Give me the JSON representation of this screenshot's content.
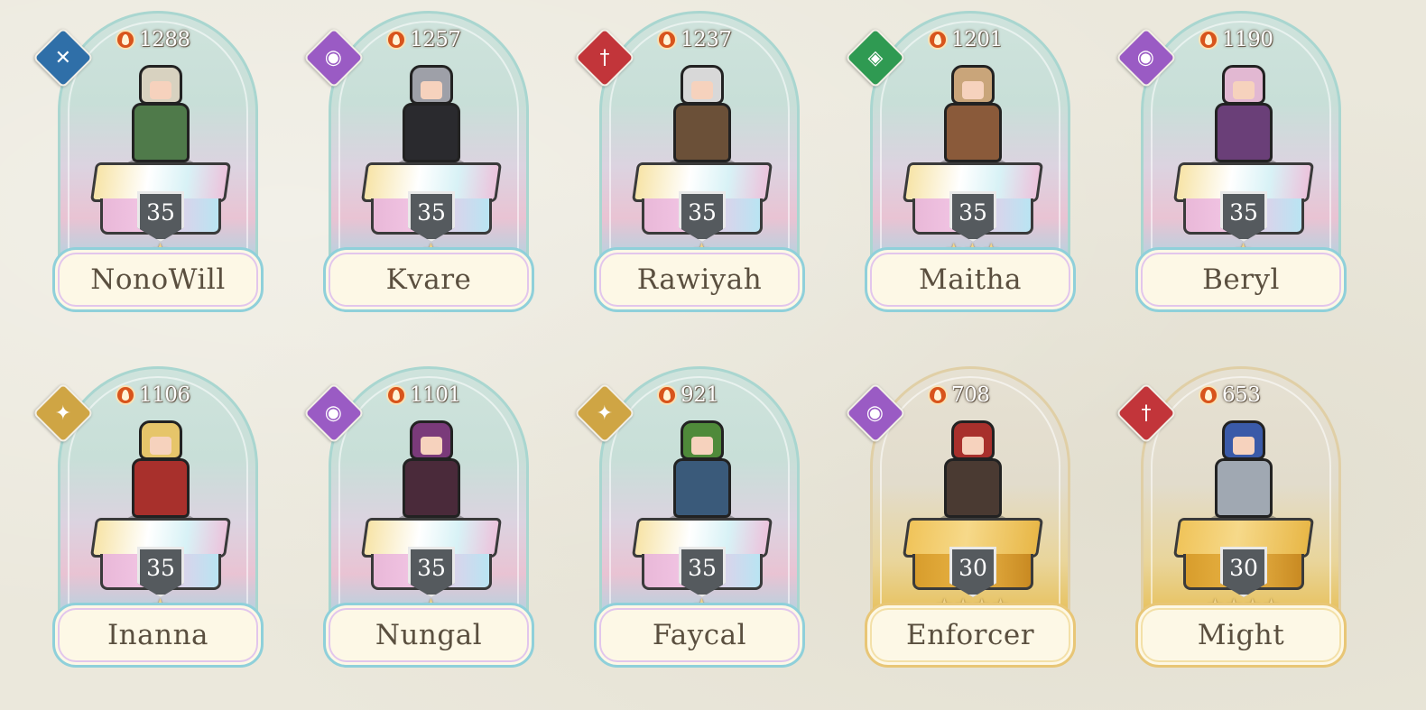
{
  "heroes": [
    {
      "name": "NonoWill",
      "power": "1288",
      "level": "35",
      "stars": "★",
      "element": "wind",
      "elementColor": "#2f6fa8",
      "body": "#4f7a4a",
      "hair": "#d8d2c0"
    },
    {
      "name": "Kvare",
      "power": "1257",
      "level": "35",
      "stars": "★",
      "element": "arcane",
      "elementColor": "#9a5bc4",
      "body": "#2a2a2e",
      "hair": "#9ea0a8"
    },
    {
      "name": "Rawiyah",
      "power": "1237",
      "level": "35",
      "stars": "★",
      "element": "fire",
      "elementColor": "#c2353a",
      "body": "#6b5038",
      "hair": "#d8d8d8"
    },
    {
      "name": "Maitha",
      "power": "1201",
      "level": "35",
      "stars": "★★★",
      "element": "earth",
      "elementColor": "#2f9a52",
      "body": "#8a5a3a",
      "hair": "#c9a57a"
    },
    {
      "name": "Beryl",
      "power": "1190",
      "level": "35",
      "stars": "★",
      "element": "arcane",
      "elementColor": "#9a5bc4",
      "body": "#6a3f78",
      "hair": "#e2b8d2"
    },
    {
      "name": "Inanna",
      "power": "1106",
      "level": "35",
      "stars": "★",
      "element": "light",
      "elementColor": "#cfa544",
      "body": "#a8302c",
      "hair": "#e6c56a"
    },
    {
      "name": "Nungal",
      "power": "1101",
      "level": "35",
      "stars": "★",
      "element": "arcane",
      "elementColor": "#9a5bc4",
      "body": "#4a2a3a",
      "hair": "#7a3a7a"
    },
    {
      "name": "Faycal",
      "power": "921",
      "level": "35",
      "stars": "★",
      "element": "light",
      "elementColor": "#cfa544",
      "body": "#3a5a7a",
      "hair": "#4f8a3a"
    },
    {
      "name": "Enforcer",
      "power": "708",
      "level": "30",
      "stars": "★★★★",
      "element": "arcane",
      "elementColor": "#9a5bc4",
      "body": "#4a3a32",
      "hair": "#a8302c"
    },
    {
      "name": "Might",
      "power": "653",
      "level": "30",
      "stars": "★★★★",
      "element": "fire",
      "elementColor": "#c2353a",
      "body": "#a0a8b2",
      "hair": "#3a5aa8"
    }
  ]
}
